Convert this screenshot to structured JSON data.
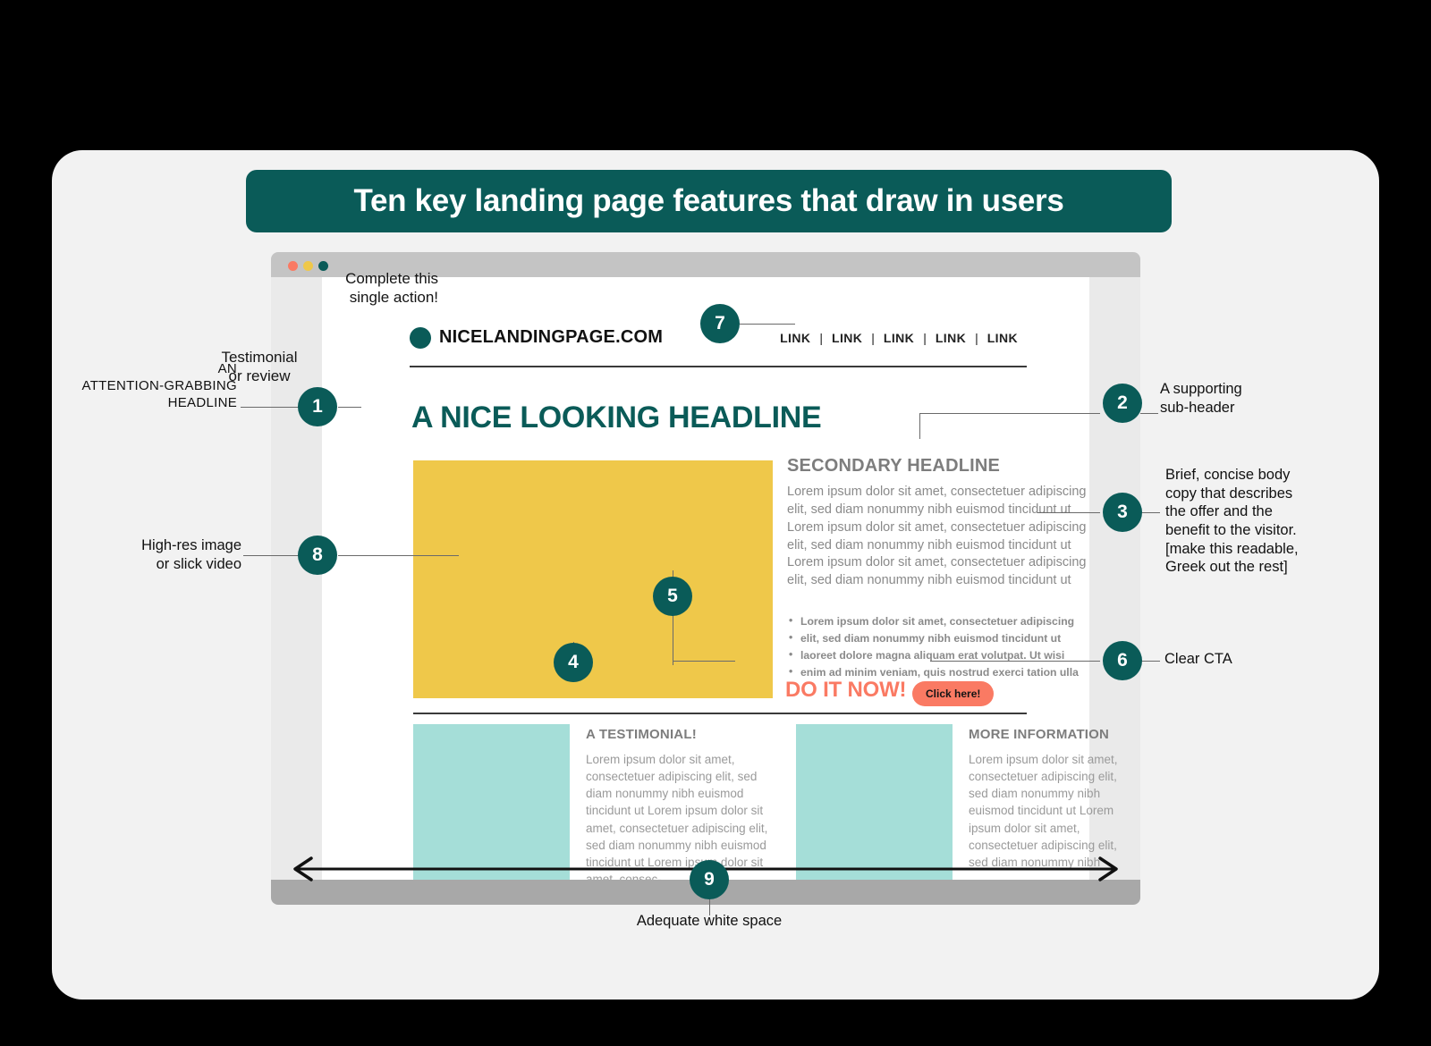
{
  "title_banner": {
    "text": "Ten key landing page features that draw in users"
  },
  "browser": {
    "dots": [
      "red",
      "yellow",
      "green"
    ]
  },
  "mock_page": {
    "site_name": "NICELANDINGPAGE.COM",
    "nav_links": [
      "LINK",
      "LINK",
      "LINK",
      "LINK",
      "LINK"
    ],
    "nav_separator": "|",
    "main_headline": "A NICE LOOKING HEADLINE",
    "secondary_headline": "SECONDARY HEADLINE",
    "body_copy": "Lorem ipsum dolor sit amet, consectetuer adipiscing elit, sed diam nonummy nibh euismod tincidunt ut Lorem ipsum dolor sit amet, consectetuer adipiscing elit, sed diam nonummy nibh euismod tincidunt ut Lorem ipsum dolor sit amet, consectetuer adipiscing elit, sed diam nonummy nibh euismod tincidunt ut",
    "bullets": [
      "Lorem ipsum dolor sit amet, consectetuer adipiscing",
      "elit, sed diam nonummy nibh euismod tincidunt ut",
      "laoreet dolore magna aliquam erat volutpat. Ut wisi",
      "enim ad minim veniam, quis nostrud exerci tation ulla"
    ],
    "cta_text": "DO IT NOW!",
    "cta_button": "Click here!",
    "hero_note_action": "Complete this\nsingle action!",
    "hero_note_testimonial": "Testimonial\nor review",
    "lower_cards": [
      {
        "title": "A TESTIMONIAL!",
        "body": "Lorem ipsum dolor sit amet, consectetuer adipiscing elit, sed diam nonummy nibh euismod tincidunt ut Lorem ipsum dolor sit amet, consectetuer adipiscing elit, sed diam nonummy nibh euismod tincidunt ut Lorem ipsum dolor sit amet, consec-"
      },
      {
        "title": "MORE INFORMATION",
        "body": "Lorem ipsum dolor sit amet, consectetuer adipiscing elit, sed diam nonummy nibh euismod tincidunt ut Lorem ipsum dolor sit amet, consectetuer adipiscing elit, sed diam nonummy nibh"
      }
    ]
  },
  "callouts": [
    {
      "number": "1",
      "label": "AN\nATTENTION-GRABBING\nHEADLINE"
    },
    {
      "number": "2",
      "label": "A supporting\nsub-header"
    },
    {
      "number": "3",
      "label": "Brief, concise body\ncopy that describes\nthe offer and the\nbenefit to the visitor.\n[make this readable,\nGreek out the rest]"
    },
    {
      "number": "4",
      "label": "Testimonial\nor review"
    },
    {
      "number": "5",
      "label": "Complete this\nsingle action!"
    },
    {
      "number": "6",
      "label": "Clear CTA"
    },
    {
      "number": "7",
      "label": ""
    },
    {
      "number": "8",
      "label": "High-res image\nor slick video"
    },
    {
      "number": "9",
      "label": "Adequate white space"
    }
  ],
  "colors": {
    "teal": "#0a5b58",
    "yellow": "#efc84a",
    "mint": "#a5ded8",
    "coral": "#fa7a63",
    "card_bg": "#f2f2f2",
    "chrome_gray": "#c4c4c4",
    "body_gray": "#8a8a8a"
  }
}
